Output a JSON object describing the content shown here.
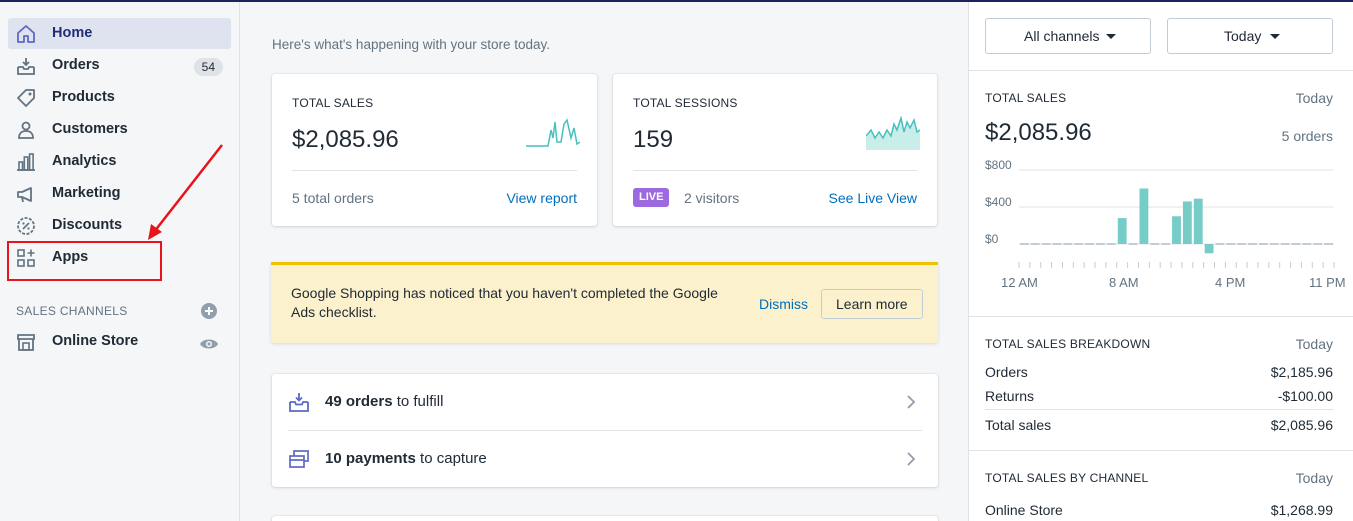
{
  "sidebar": {
    "items": [
      {
        "label": "Home",
        "icon": "home-icon",
        "active": true
      },
      {
        "label": "Orders",
        "icon": "orders-icon",
        "badge": "54"
      },
      {
        "label": "Products",
        "icon": "tag-icon"
      },
      {
        "label": "Customers",
        "icon": "person-icon"
      },
      {
        "label": "Analytics",
        "icon": "bar-chart-icon"
      },
      {
        "label": "Marketing",
        "icon": "megaphone-icon"
      },
      {
        "label": "Discounts",
        "icon": "discount-icon"
      },
      {
        "label": "Apps",
        "icon": "apps-icon"
      }
    ],
    "sales_channels_heading": "SALES CHANNELS",
    "online_store": "Online Store"
  },
  "main": {
    "subtitle": "Here's what's happening with your store today.",
    "total_sales_card": {
      "label": "TOTAL SALES",
      "value": "$2,085.96",
      "footer": "5 total orders",
      "link": "View report"
    },
    "total_sessions_card": {
      "label": "TOTAL SESSIONS",
      "value": "159",
      "live": "LIVE",
      "visitors": "2 visitors",
      "link": "See Live View"
    },
    "banner": {
      "text": "Google Shopping has noticed that you haven't completed the Google Ads checklist.",
      "dismiss": "Dismiss",
      "learn_more": "Learn more"
    },
    "tasks": [
      {
        "bold": "49 orders",
        "rest": " to fulfill",
        "icon": "fulfill-icon"
      },
      {
        "bold": "10 payments",
        "rest": " to capture",
        "icon": "payment-icon"
      }
    ]
  },
  "right_panel": {
    "channels_dropdown": "All channels",
    "date_dropdown": "Today",
    "total_sales": {
      "heading": "TOTAL SALES",
      "date": "Today",
      "value": "$2,085.96",
      "orders": "5 orders"
    },
    "breakdown": {
      "heading": "TOTAL SALES BREAKDOWN",
      "date": "Today",
      "rows": [
        {
          "label": "Orders",
          "value": "$2,185.96"
        },
        {
          "label": "Returns",
          "value": "-$100.00"
        },
        {
          "label": "Total sales",
          "value": "$2,085.96"
        }
      ]
    },
    "by_channel": {
      "heading": "TOTAL SALES BY CHANNEL",
      "date": "Today",
      "rows": [
        {
          "label": "Online Store",
          "value": "$1,268.99"
        }
      ]
    }
  },
  "chart_data": {
    "type": "bar",
    "ylim": [
      -100,
      800
    ],
    "yticks": [
      "$800",
      "$400",
      "$0"
    ],
    "xticks": [
      "12 AM",
      "8 AM",
      "4 PM",
      "11 PM"
    ],
    "values": [
      0,
      0,
      0,
      0,
      0,
      0,
      0,
      0,
      0,
      280,
      0,
      600,
      0,
      0,
      300,
      460,
      490,
      -100,
      0,
      0,
      0,
      0,
      0,
      0,
      0,
      0,
      0,
      0,
      0
    ],
    "color": "#76cdc7",
    "baseline_color": "#c4cdd5"
  },
  "colors": {
    "accent": "#006fbb",
    "live": "#9c6ade",
    "annotation": "#e8131b",
    "sparkline": "#47c1bf"
  }
}
